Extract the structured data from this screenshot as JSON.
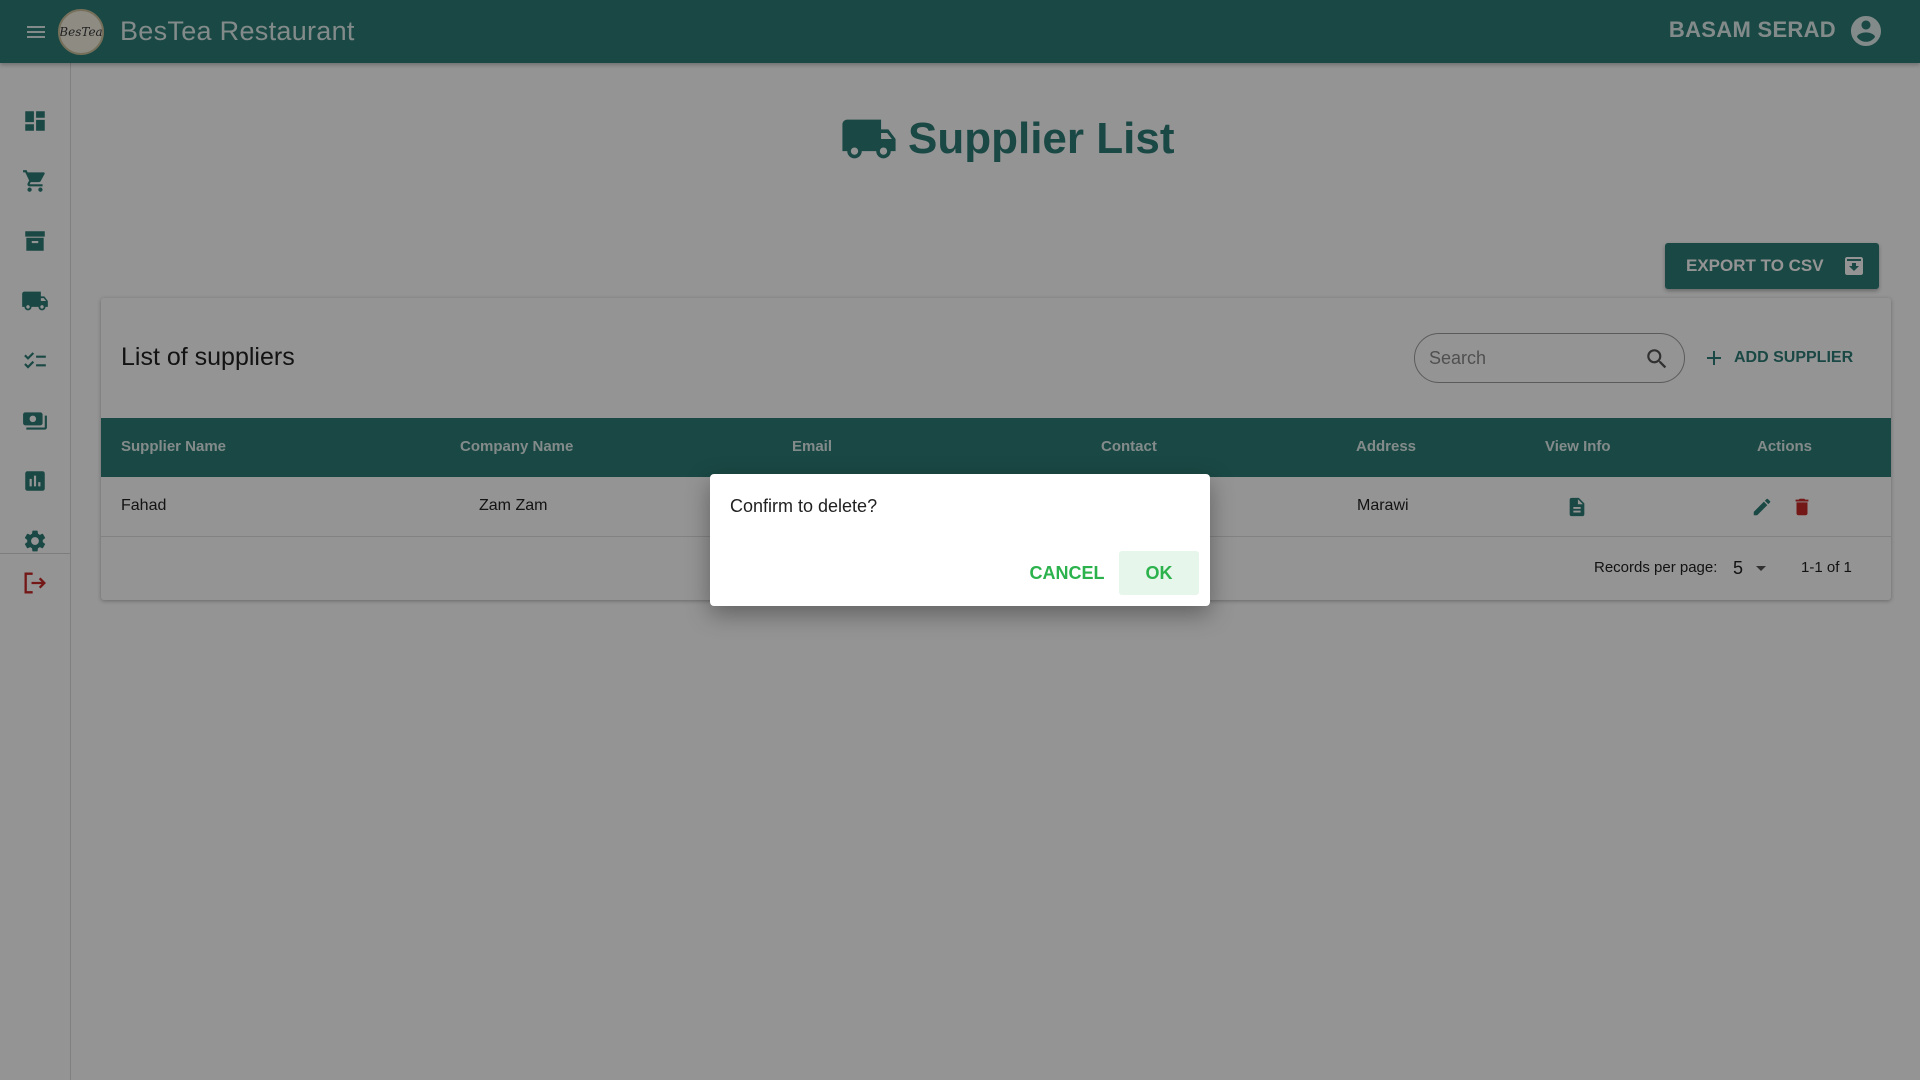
{
  "app": {
    "title": "BesTea Restaurant",
    "logo_text": "BesTea",
    "user_name": "BASAM SERAD"
  },
  "colors": {
    "primary": "#2e7d76",
    "danger": "#c62828",
    "dialog_accent": "#2bb24c"
  },
  "sidebar": {
    "items": [
      {
        "icon": "dashboard-icon"
      },
      {
        "icon": "cart-icon"
      },
      {
        "icon": "archive-icon"
      },
      {
        "icon": "truck-icon"
      },
      {
        "icon": "checklist-icon"
      },
      {
        "icon": "payments-icon"
      },
      {
        "icon": "report-chart-icon"
      },
      {
        "icon": "gear-icon"
      },
      {
        "icon": "logout-icon"
      }
    ]
  },
  "page": {
    "title": "Supplier List",
    "export_label": "EXPORT TO CSV"
  },
  "card": {
    "title": "List of suppliers",
    "search_placeholder": "Search",
    "add_label": "ADD SUPPLIER"
  },
  "table": {
    "columns": [
      "Supplier Name",
      "Company Name",
      "Email",
      "Contact",
      "Address",
      "View Info",
      "Actions"
    ],
    "rows": [
      {
        "supplier_name": "Fahad",
        "company_name": "Zam Zam",
        "email": "",
        "contact": "",
        "address": "Marawi"
      }
    ]
  },
  "pagination": {
    "label": "Records per page:",
    "per_page": "5",
    "range": "1-1 of 1"
  },
  "dialog": {
    "message": "Confirm to delete?",
    "cancel_label": "CANCEL",
    "ok_label": "OK"
  }
}
